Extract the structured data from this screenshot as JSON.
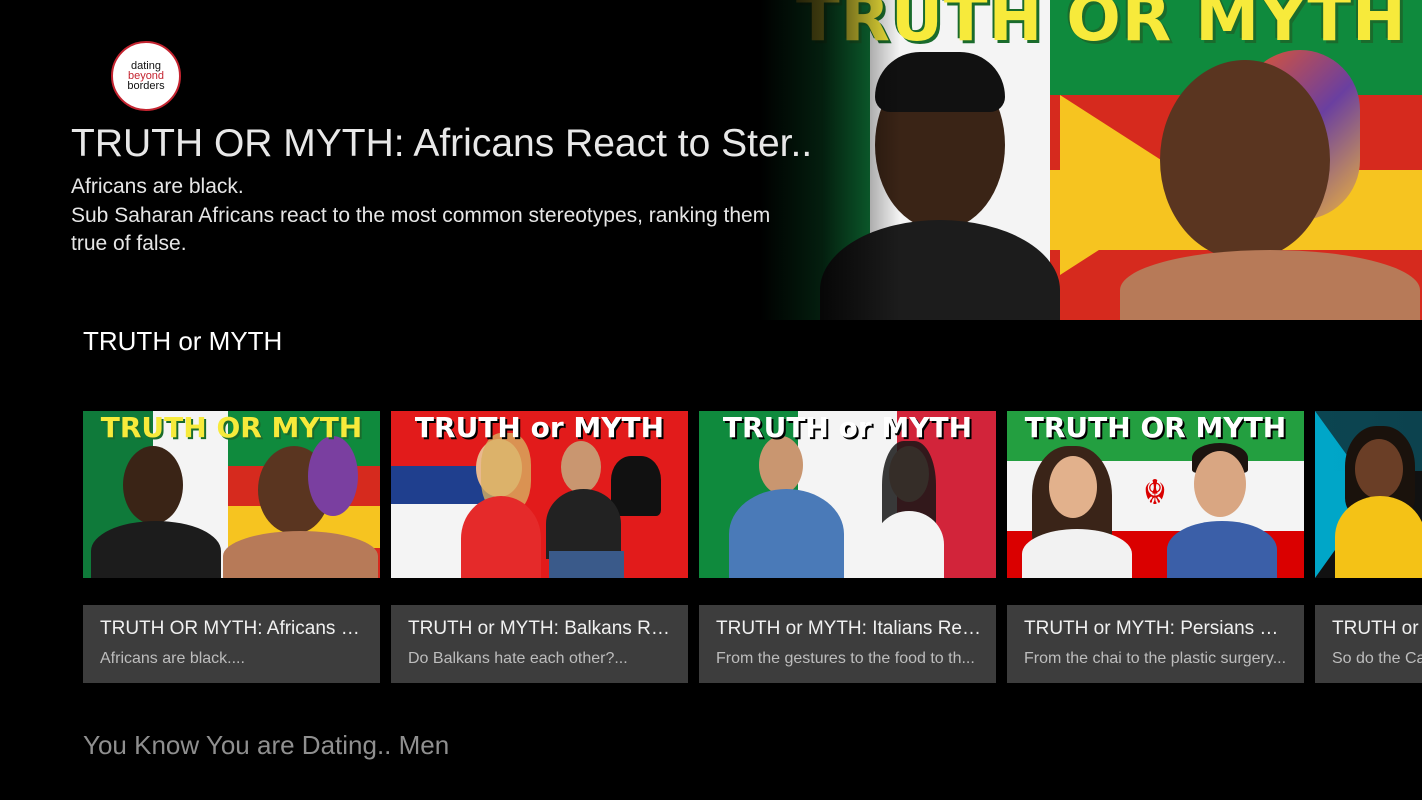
{
  "brand": {
    "logo_line1": "dating",
    "logo_line2": "beyond",
    "logo_line3": "borders"
  },
  "hero": {
    "title": "TRUTH OR MYTH:  Africans React to Ster..",
    "description_line1": "Africans are black.",
    "description_line2": "Sub Saharan Africans react to the most common stereotypes, ranking them true of false.",
    "artwork_text": "TRUTH OR MYTH"
  },
  "rows": [
    {
      "title": "TRUTH or MYTH",
      "cards": [
        {
          "thumb_text": "TRUTH OR MYTH",
          "title": "TRUTH OR MYTH:  Africans Re...",
          "description": "Africans are black...."
        },
        {
          "thumb_text": "TRUTH or MYTH",
          "title": "TRUTH or MYTH: Balkans Rea...",
          "description": "Do Balkans hate each other?..."
        },
        {
          "thumb_text": "TRUTH or MYTH",
          "title": "TRUTH or MYTH: Italians Reac...",
          "description": "From the gestures to the food to th..."
        },
        {
          "thumb_text": "TRUTH OR MYTH",
          "title": "TRUTH or MYTH: Persians Rea...",
          "description": "From the chai to the plastic surgery..."
        },
        {
          "thumb_text": "",
          "title": "TRUTH or M",
          "description": "So do the Ca"
        }
      ]
    },
    {
      "title": "You Know You are Dating.. Men"
    }
  ],
  "colors": {
    "background": "#000000",
    "card_info_bg": "#3d3d3d",
    "logo_accent": "#c42430"
  }
}
